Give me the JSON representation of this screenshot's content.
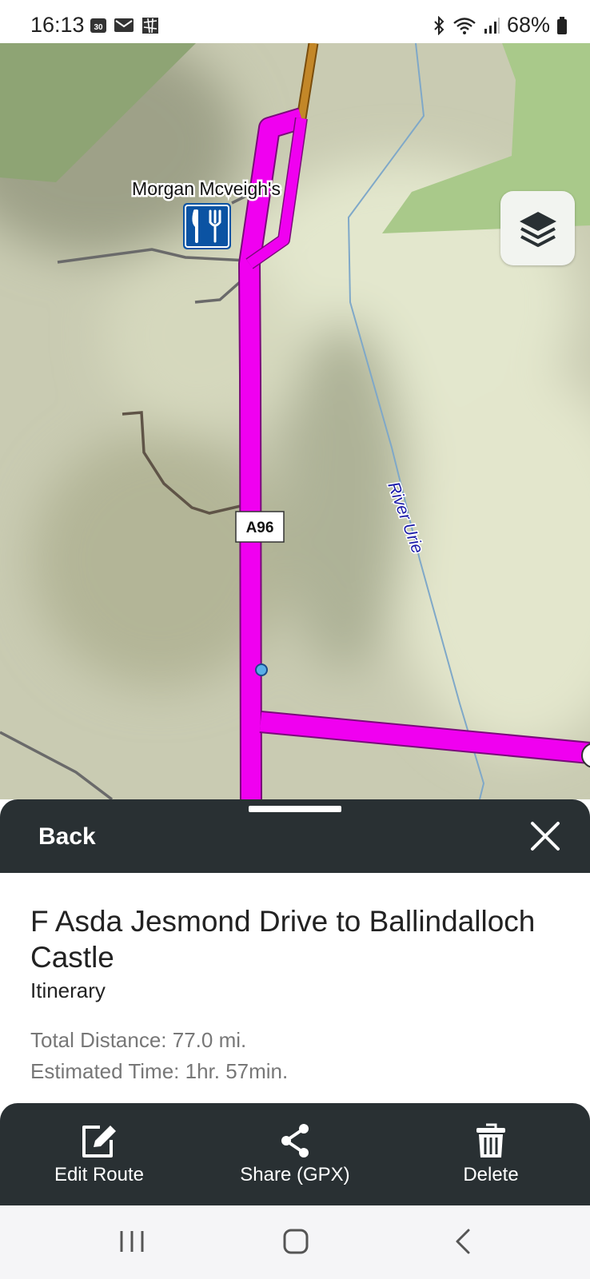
{
  "status_bar": {
    "time": "16:13",
    "battery": "68%",
    "left_icons": [
      "calendar-icon",
      "mail-icon",
      "app-icon"
    ],
    "right_icons": [
      "bluetooth-icon",
      "wifi-icon",
      "signal-icon",
      "battery-icon"
    ]
  },
  "map": {
    "poi_label": "Morgan  Mcveigh's",
    "poi_icon": "restaurant-icon",
    "road_label": "A96",
    "river_label": "River Urie",
    "route_color": "#f000f0",
    "layers_icon": "layers-icon"
  },
  "sheet": {
    "back_label": "Back",
    "close_icon": "close-icon",
    "title": "F Asda Jesmond Drive to Ballindalloch Castle",
    "type": "Itinerary",
    "distance": "Total Distance: 77.0 mi.",
    "time": "Estimated Time: 1hr. 57min."
  },
  "actions": {
    "edit": "Edit Route",
    "share": "Share (GPX)",
    "delete": "Delete"
  },
  "nav": {
    "recents_icon": "recents-icon",
    "home_icon": "home-icon",
    "back_icon": "back-icon"
  },
  "colors": {
    "dark_panel": "#293033",
    "map_base": "#c9cbb2",
    "forest": "#a9c98a"
  }
}
